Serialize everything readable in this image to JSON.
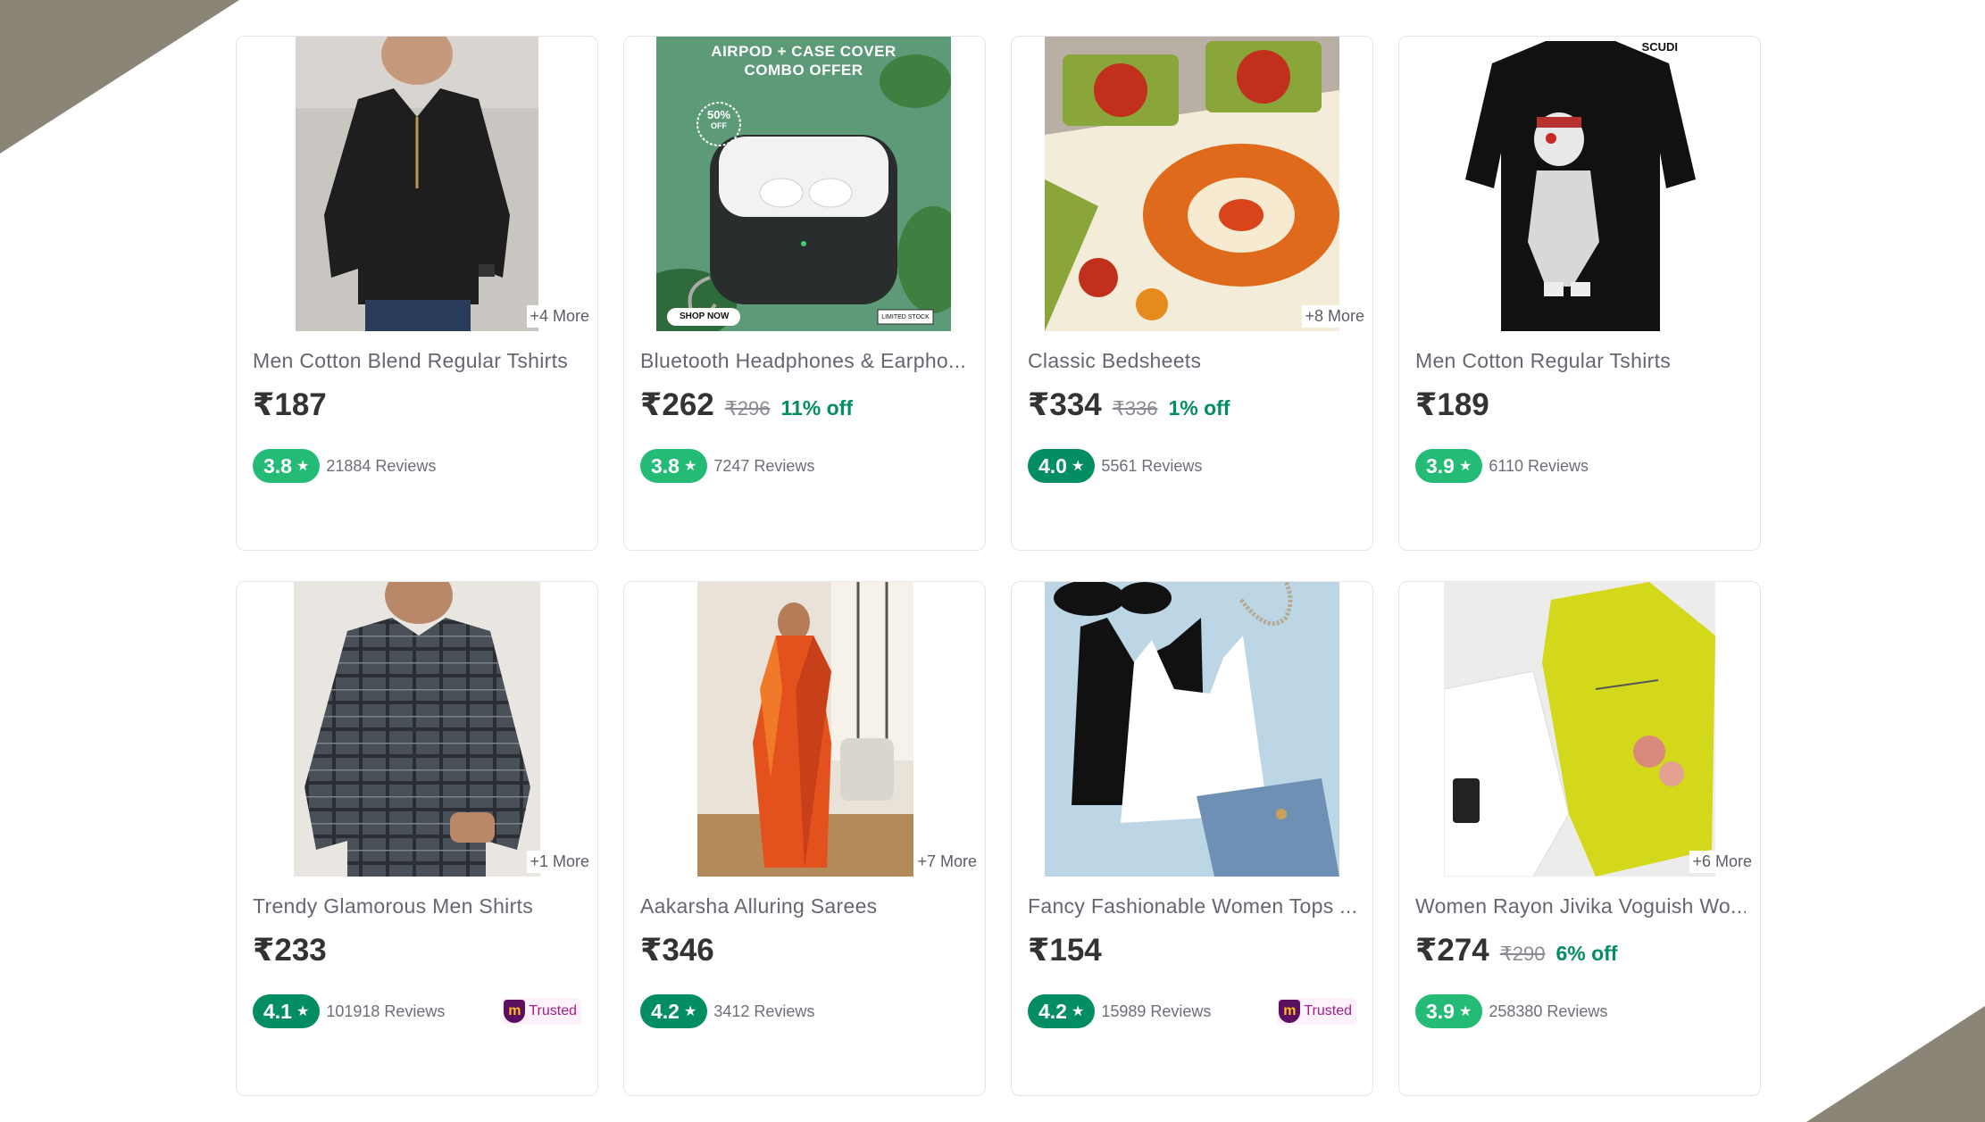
{
  "colors": {
    "rating_green": "#23bb75",
    "rating_dark_green": "#038d63",
    "discount_green": "#038d63",
    "corner_shape": "#8a8577",
    "trusted_purple": "#9f2089"
  },
  "products": [
    {
      "title": "Men Cotton Blend Regular Tshirts",
      "price": "₹187",
      "mrp": "",
      "discount": "",
      "rating": "3.8",
      "rating_color": "#23bb75",
      "reviews": "21884 Reviews",
      "more": "+4 More",
      "image_icon": "black-tshirt-image",
      "trusted": ""
    },
    {
      "title": "Bluetooth Headphones & Earpho...",
      "price": "₹262",
      "mrp": "₹296",
      "discount": "11% off",
      "rating": "3.8",
      "rating_color": "#23bb75",
      "reviews": "7247 Reviews",
      "more": "",
      "image_icon": "airpod-case-image",
      "banner_line1": "AIRPOD + CASE COVER",
      "banner_line2": "COMBO OFFER",
      "badge_pct": "50%",
      "badge_off": "OFF",
      "shop_now": "SHOP NOW",
      "limited": "LIMITED STOCK",
      "trusted": ""
    },
    {
      "title": "Classic Bedsheets",
      "price": "₹334",
      "mrp": "₹336",
      "discount": "1% off",
      "rating": "4.0",
      "rating_color": "#038d63",
      "reviews": "5561 Reviews",
      "more": "+8 More",
      "image_icon": "floral-bedsheet-image",
      "trusted": ""
    },
    {
      "title": "Men Cotton Regular Tshirts",
      "price": "₹189",
      "mrp": "",
      "discount": "",
      "rating": "3.9",
      "rating_color": "#23bb75",
      "reviews": "6110 Reviews",
      "more": "",
      "image_icon": "skeleton-tshirt-image",
      "brand": "SCUDI",
      "trusted": ""
    },
    {
      "title": "Trendy Glamorous Men Shirts",
      "price": "₹233",
      "mrp": "",
      "discount": "",
      "rating": "4.1",
      "rating_color": "#038d63",
      "reviews": "101918 Reviews",
      "more": "+1 More",
      "image_icon": "checked-shirt-image",
      "trusted": "Trusted"
    },
    {
      "title": "Aakarsha Alluring Sarees",
      "price": "₹346",
      "mrp": "",
      "discount": "",
      "rating": "4.2",
      "rating_color": "#038d63",
      "reviews": "3412 Reviews",
      "more": "+7 More",
      "image_icon": "orange-saree-image",
      "trusted": ""
    },
    {
      "title": "Fancy Fashionable Women Tops ...",
      "price": "₹154",
      "mrp": "",
      "discount": "",
      "rating": "4.2",
      "rating_color": "#038d63",
      "reviews": "15989 Reviews",
      "more": "",
      "image_icon": "crop-tops-image",
      "trusted": "Trusted"
    },
    {
      "title": "Women Rayon Jivika Voguish Wo...",
      "price": "₹274",
      "mrp": "₹290",
      "discount": "6% off",
      "rating": "3.9",
      "rating_color": "#23bb75",
      "reviews": "258380 Reviews",
      "more": "+6 More",
      "image_icon": "yellow-kurti-image",
      "trusted": ""
    }
  ]
}
